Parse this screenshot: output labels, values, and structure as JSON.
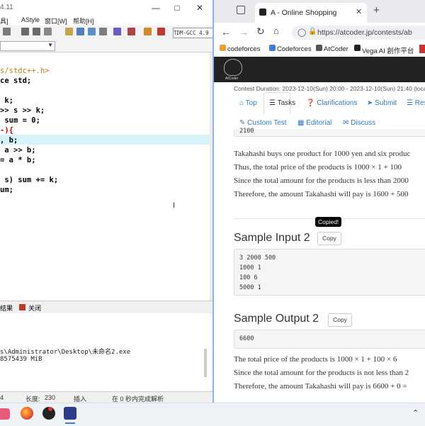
{
  "ide": {
    "title_fragment": "4.11",
    "menu": [
      "具]",
      "AStyle",
      "窗口[W]",
      "帮助[H]"
    ],
    "compiler": "TDM-GCC 4.9",
    "code_lines": [
      "s/stdc++.h>",
      "ce std;",
      "",
      " k;",
      ">> s >> k;",
      " sum = 0;",
      "-){",
      ", b;",
      " a >> b;",
      "= a * b;",
      "",
      " s) sum += k;",
      "um;"
    ],
    "bottom_tabs": [
      "结果",
      "关闭"
    ],
    "output_lines": [
      "s\\Administrator\\Desktop\\未命名2.exe",
      "8575439 MiB"
    ],
    "status": {
      "line_prefix": "4",
      "length_label": "长度:",
      "length_value": "230",
      "mode": "插入",
      "parse_msg": "在 0 秒内完成解析"
    }
  },
  "browser": {
    "tab_title": "A - Online Shopping",
    "url": "https://atcoder.jp/contests/ab",
    "bookmarks": [
      "codeforces",
      "Codeforces",
      "AtCoder",
      "Vega AI 創作平台"
    ],
    "logo_text": "AtCoder",
    "contest_duration": "Contest Duration: 2023-12-10(Sun) 20:00 - 2023-12-10(Sun) 21:40 (local ti",
    "nav_tabs": [
      "Top",
      "Tasks",
      "Clarifications",
      "Submit",
      "Res",
      "Custom Test",
      "Editorial",
      "Discuss"
    ],
    "prev_output_fragment": "2100",
    "explanation1": [
      "Takahashi buys one product for 1000 yen and six produc",
      "Thus, the total price of the products is 1000 × 1 + 100",
      "Since the total amount for the products is less than 2000",
      "Therefore, the amount Takahashi will pay is 1600 + 500"
    ],
    "sample_input2": {
      "title": "Sample Input 2",
      "copy": "Copy",
      "tooltip": "Copied!",
      "lines": [
        "3 2000 500",
        "1000 1",
        "100 6",
        "5000 1"
      ]
    },
    "sample_output2": {
      "title": "Sample Output 2",
      "copy": "Copy",
      "lines": [
        "6600"
      ]
    },
    "explanation2": [
      "The total price of the products is 1000 × 1 + 100 × 6",
      "Since the total amount for the products is not less than 2",
      "Therefore, the amount Takahashi will pay is 6600 + 0 ="
    ]
  },
  "colors": {
    "accent": "#337ab7",
    "highlight_row": "#d6f3fa",
    "atcoder_header": "#222222"
  }
}
